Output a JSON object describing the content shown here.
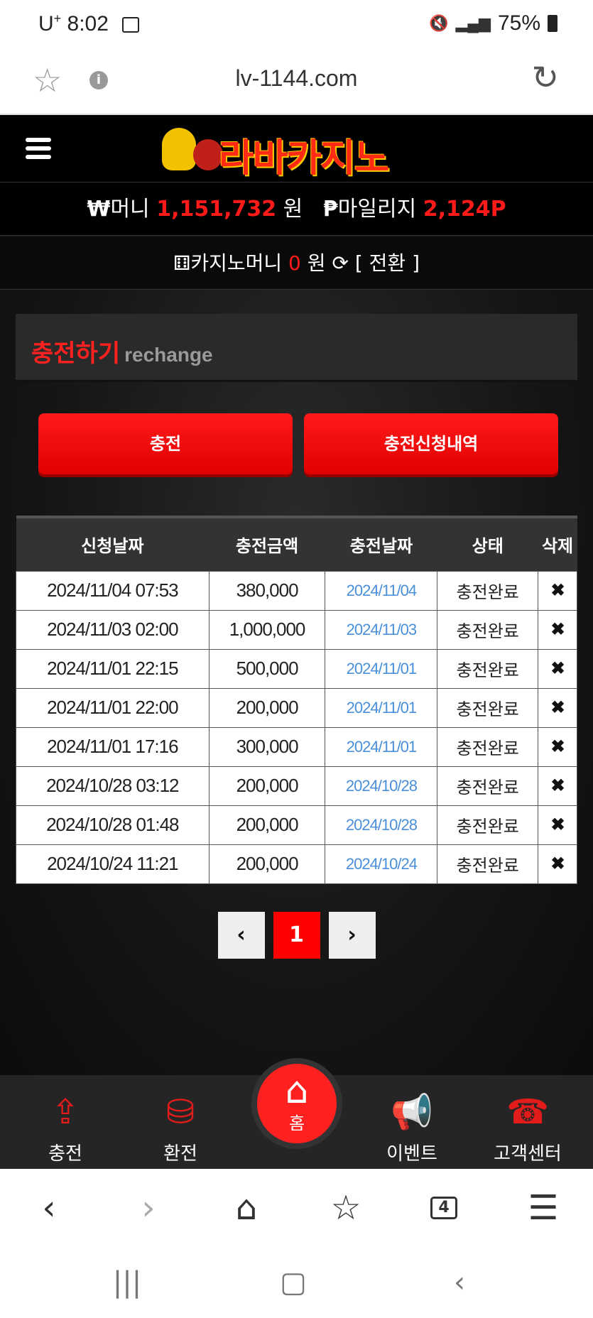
{
  "status_bar": {
    "time": "8:02",
    "carrier": "U",
    "battery": "75%"
  },
  "browser": {
    "url": "lv-1144.com"
  },
  "site": {
    "logo_text": "라바카지노",
    "money_label": "머니",
    "money_value": "1,151,732",
    "money_unit": "원",
    "mileage_label": "마일리지",
    "mileage_value": "2,124",
    "mileage_unit": "P",
    "casino_label": "카지노머니",
    "casino_value": "0",
    "casino_unit": "원",
    "swap_label": "[ 전환 ]"
  },
  "panel": {
    "title": "충전하기",
    "subtitle": "rechange"
  },
  "buttons": {
    "charge": "충전",
    "history": "충전신청내역"
  },
  "table": {
    "headers": [
      "신청날짜",
      "충전금액",
      "충전날짜",
      "상태",
      "삭제"
    ],
    "rows": [
      {
        "req": "2024/11/04 07:53",
        "amount": "380,000",
        "date": "2024/11/04",
        "status": "충전완료"
      },
      {
        "req": "2024/11/03 02:00",
        "amount": "1,000,000",
        "date": "2024/11/03",
        "status": "충전완료"
      },
      {
        "req": "2024/11/01 22:15",
        "amount": "500,000",
        "date": "2024/11/01",
        "status": "충전완료"
      },
      {
        "req": "2024/11/01 22:00",
        "amount": "200,000",
        "date": "2024/11/01",
        "status": "충전완료"
      },
      {
        "req": "2024/11/01 17:16",
        "amount": "300,000",
        "date": "2024/11/01",
        "status": "충전완료"
      },
      {
        "req": "2024/10/28 03:12",
        "amount": "200,000",
        "date": "2024/10/28",
        "status": "충전완료"
      },
      {
        "req": "2024/10/28 01:48",
        "amount": "200,000",
        "date": "2024/10/28",
        "status": "충전완료"
      },
      {
        "req": "2024/10/24 11:21",
        "amount": "200,000",
        "date": "2024/10/24",
        "status": "충전완료"
      }
    ]
  },
  "pager": {
    "current": "1"
  },
  "bottom_nav": {
    "charge": "충전",
    "exchange": "환전",
    "home": "홈",
    "event": "이벤트",
    "support": "고객센터"
  },
  "browser_tabs_count": "4",
  "colors": {
    "accent": "#ff1a1a",
    "link_date": "#4a8fd9"
  }
}
